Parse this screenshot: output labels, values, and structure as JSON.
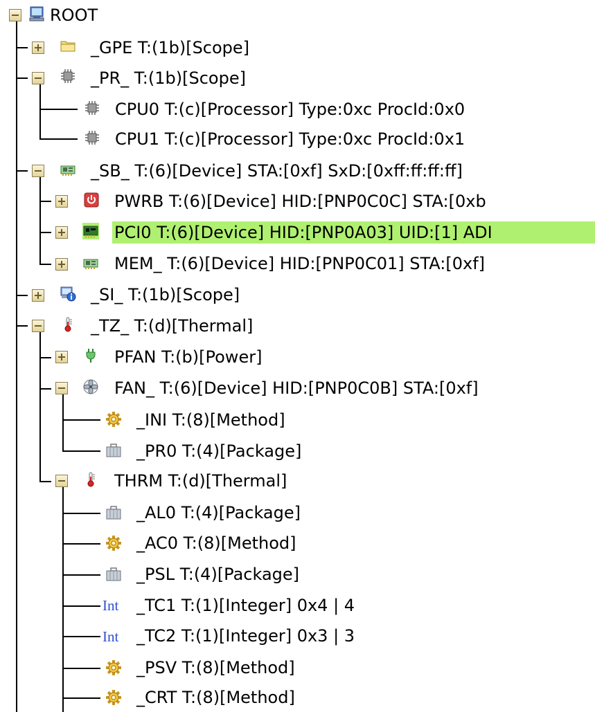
{
  "colors": {
    "selection_bg": "#b0f070",
    "tree_line": "#000000",
    "int_label": "#2d4fd6"
  },
  "tree": {
    "nodes": [
      {
        "label": "ROOT",
        "icon": "computer-icon",
        "toggle": "expanded"
      },
      {
        "label": "_GPE T:(1b)[Scope]",
        "icon": "folder-icon",
        "toggle": "collapsed"
      },
      {
        "label": "_PR_ T:(1b)[Scope]",
        "icon": "chip-icon",
        "toggle": "expanded"
      },
      {
        "label": "CPU0 T:(c)[Processor] Type:0xc ProcId:0x0",
        "icon": "chip-icon",
        "toggle": "none"
      },
      {
        "label": "CPU1 T:(c)[Processor] Type:0xc ProcId:0x1",
        "icon": "chip-icon",
        "toggle": "none"
      },
      {
        "label": "_SB_ T:(6)[Device] STA:[0xf] SxD:[0xff:ff:ff:ff]",
        "icon": "device-card-icon",
        "toggle": "expanded"
      },
      {
        "label": "PWRB T:(6)[Device] HID:[PNP0C0C] STA:[0xb",
        "icon": "power-button-icon",
        "toggle": "collapsed"
      },
      {
        "label": "PCI0 T:(6)[Device] HID:[PNP0A03] UID:[1] ADI",
        "icon": "pci-board-icon",
        "toggle": "collapsed",
        "selected": true
      },
      {
        "label": "MEM_ T:(6)[Device] HID:[PNP0C01] STA:[0xf]",
        "icon": "device-card-icon",
        "toggle": "collapsed"
      },
      {
        "label": "_SI_ T:(1b)[Scope]",
        "icon": "system-info-icon",
        "toggle": "collapsed"
      },
      {
        "label": "_TZ_ T:(d)[Thermal]",
        "icon": "thermometer-icon",
        "toggle": "expanded"
      },
      {
        "label": "PFAN T:(b)[Power]",
        "icon": "power-plug-icon",
        "toggle": "collapsed"
      },
      {
        "label": "FAN_ T:(6)[Device] HID:[PNP0C0B] STA:[0xf]",
        "icon": "fan-icon",
        "toggle": "expanded"
      },
      {
        "label": "_INI T:(8)[Method]",
        "icon": "gear-icon",
        "toggle": "none"
      },
      {
        "label": "_PR0 T:(4)[Package]",
        "icon": "package-icon",
        "toggle": "none"
      },
      {
        "label": "THRM T:(d)[Thermal]",
        "icon": "thermometer-icon",
        "toggle": "expanded"
      },
      {
        "label": "_AL0 T:(4)[Package]",
        "icon": "package-icon",
        "toggle": "none"
      },
      {
        "label": "_AC0 T:(8)[Method]",
        "icon": "gear-icon",
        "toggle": "none"
      },
      {
        "label": "_PSL T:(4)[Package]",
        "icon": "package-icon",
        "toggle": "none"
      },
      {
        "label": "_TC1 T:(1)[Integer] 0x4 | 4",
        "icon": "integer-icon",
        "icon_text": "Int",
        "toggle": "none"
      },
      {
        "label": "_TC2 T:(1)[Integer] 0x3 | 3",
        "icon": "integer-icon",
        "icon_text": "Int",
        "toggle": "none"
      },
      {
        "label": "_PSV T:(8)[Method]",
        "icon": "gear-icon",
        "toggle": "none"
      },
      {
        "label": "_CRT T:(8)[Method]",
        "icon": "gear-icon",
        "toggle": "none"
      }
    ]
  }
}
